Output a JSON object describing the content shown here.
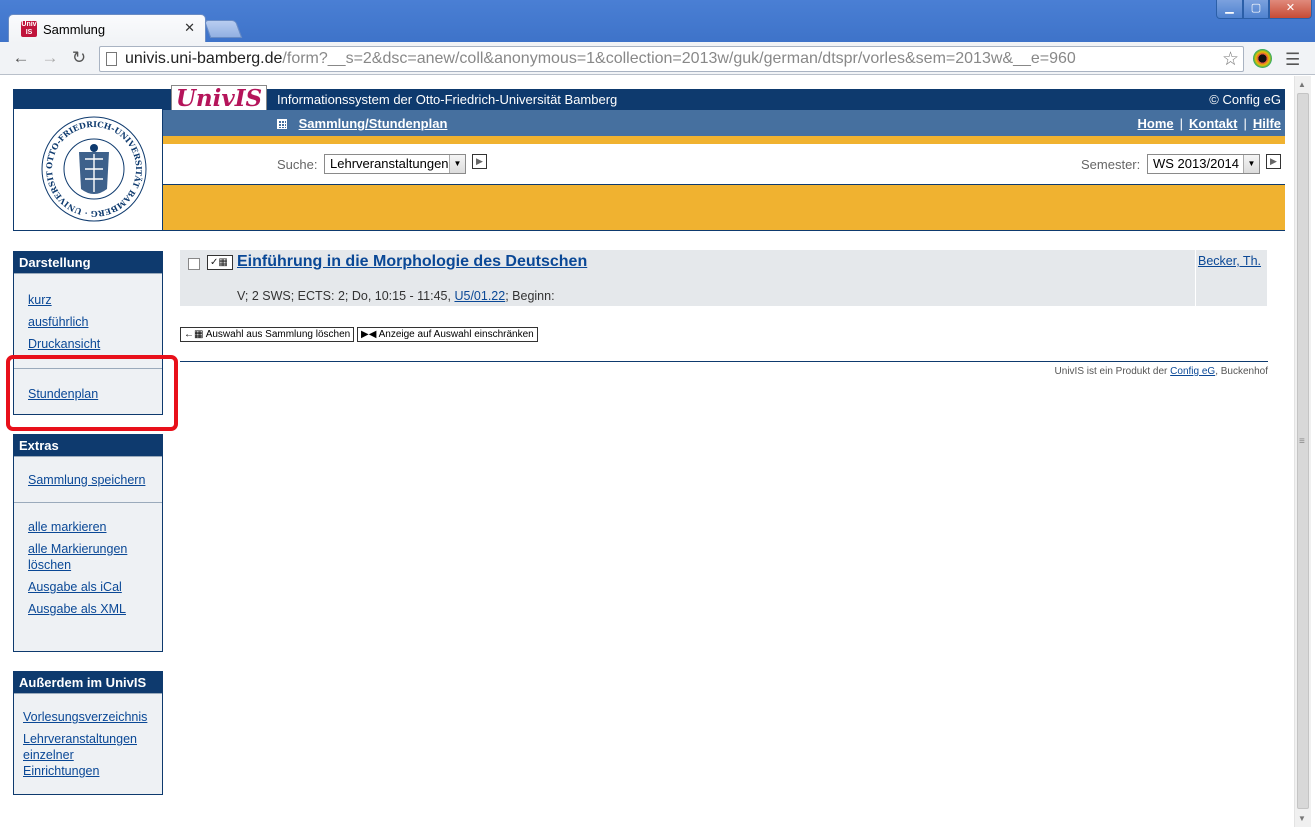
{
  "browser": {
    "tab_title": "Sammlung",
    "favicon_text": "UnivIS",
    "url_host": "univis.uni-bamberg.de",
    "url_path": "/form?__s=2&dsc=anew/coll&anonymous=1&collection=2013w/guk/german/dtspr/vorles&sem=2013w&__e=960"
  },
  "header": {
    "logo_text": "UnivIS",
    "info_title": "Informationssystem der Otto-Friedrich-Universität Bamberg",
    "copyright": "© Config eG",
    "section_link": "Sammlung/Stundenplan",
    "nav": {
      "home": "Home",
      "kontakt": "Kontakt",
      "hilfe": "Hilfe",
      "separator": "|"
    },
    "search_label": "Suche:",
    "search_value": "Lehrveranstaltungen",
    "semester_label": "Semester:",
    "semester_value": "WS 2013/2014"
  },
  "sidebar": {
    "darstellung": {
      "title": "Darstellung",
      "items": [
        "kurz",
        "ausführlich",
        "Druckansicht"
      ],
      "stundenplan": "Stundenplan"
    },
    "extras": {
      "title": "Extras",
      "save": "Sammlung speichern",
      "items": [
        "alle markieren",
        "alle Markierungen löschen",
        "Ausgabe als iCal",
        "Ausgabe als XML"
      ]
    },
    "ausserdem": {
      "title": "Außerdem im UnivIS",
      "items": [
        "Vorlesungsverzeichnis",
        "Lehrveranstaltungen einzelner Einrichtungen"
      ]
    }
  },
  "course": {
    "title": "Einführung in die Morphologie des Deutschen",
    "meta_prefix": "V; 2 SWS; ECTS: 2; Do, 10:15 - 11:45, ",
    "room": "U5/01.22",
    "meta_suffix": "; Beginn:",
    "lecturer": "Becker, Th."
  },
  "actions": {
    "delete_selection": "Auswahl aus Sammlung löschen",
    "restrict_selection": "Anzeige auf Auswahl einschränken"
  },
  "footer": {
    "prefix": "UnivIS ist ein Produkt der ",
    "company": "Config eG",
    "suffix": ", Buckenhof"
  },
  "seal_text": "OTTO-FRIEDRICH-UNIVERSITÄT BAMBERG · UNIVERSITY OF BAMBERG",
  "colors": {
    "navy": "#0e3a6e",
    "blue_bar": "#46709f",
    "gold": "#f0b230",
    "highlight": "#e8101a",
    "link": "#0a4896"
  }
}
